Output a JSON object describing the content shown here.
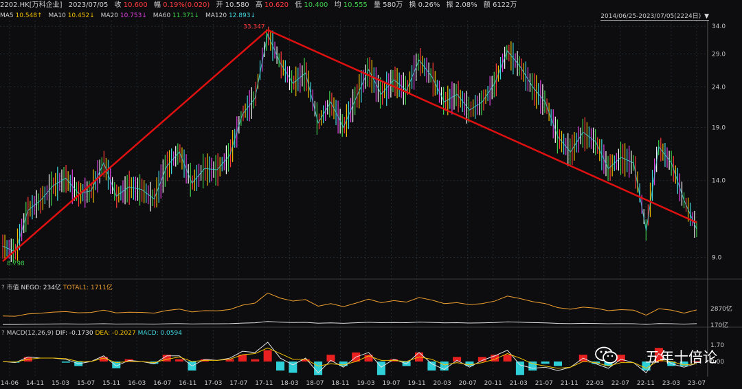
{
  "header": {
    "symbol": "2202.HK[万科企业]",
    "date": "2023/07/05",
    "close_label": "收",
    "close": "10.600",
    "change_label": "幅",
    "change": "0.19%(0.020)",
    "open_label": "开",
    "open": "10.580",
    "high_label": "高",
    "high": "10.620",
    "low_label": "低",
    "low": "10.400",
    "avg_label": "均",
    "avg": "10.555",
    "vol_label": "量",
    "vol": "580万",
    "turnover_label": "换",
    "turnover": "0.26%",
    "amp_label": "振",
    "amp": "2.08%",
    "amount_label": "额",
    "amount": "6122万"
  },
  "ma_line": [
    {
      "label": "MA5",
      "value": "10.548↑",
      "color": "#ffffff"
    },
    {
      "label": "MA10",
      "value": "10.452↓",
      "color": "#f0c000"
    },
    {
      "label": "MA20",
      "value": "10.753↓",
      "color": "#e040e0"
    },
    {
      "label": "MA60",
      "value": "11.371↓",
      "color": "#3fd04a"
    },
    {
      "label": "MA120",
      "value": "12.893↓",
      "color": "#40d8e0"
    }
  ],
  "range_label": "2014/06/25-2023/07/05(2224日)",
  "range_arrow": "▼",
  "chart_data": [
    {
      "type": "line",
      "title": "2202.HK[万科企业]",
      "y_scale": "log",
      "ylim": [
        8.4,
        34.3
      ],
      "yticks": [
        "34.0",
        "29.0",
        "24.0",
        "19.0",
        "14.0",
        "9.0"
      ],
      "xticks": [
        "14-06",
        "14-11",
        "15-03",
        "15-07",
        "15-11",
        "16-03",
        "16-07",
        "16-11",
        "17-03",
        "17-07",
        "17-11",
        "18-03",
        "18-07",
        "18-11",
        "19-03",
        "19-07",
        "19-11",
        "20-03",
        "20-07",
        "20-11",
        "21-03",
        "21-07",
        "21-11",
        "22-03",
        "22-07",
        "22-11",
        "23-03",
        "23-07"
      ],
      "annotations": {
        "high_label": "33.347",
        "low_label": "8.798"
      },
      "trendlines": [
        {
          "from": [
            "14-06",
            8.8
          ],
          "to": [
            "17-12",
            33.3
          ],
          "color": "#e01010"
        },
        {
          "from": [
            "17-12",
            33.3
          ],
          "to": [
            "23-07",
            11.0
          ],
          "color": "#e01010"
        }
      ],
      "series": [
        {
          "name": "Price",
          "x": [
            "14-06",
            "14-08",
            "14-11",
            "15-01",
            "15-03",
            "15-05",
            "15-07",
            "15-09",
            "15-11",
            "16-01",
            "16-03",
            "16-05",
            "16-07",
            "16-09",
            "16-11",
            "17-01",
            "17-03",
            "17-05",
            "17-07",
            "17-09",
            "17-11",
            "17-12",
            "18-01",
            "18-03",
            "18-05",
            "18-07",
            "18-09",
            "18-11",
            "19-01",
            "19-03",
            "19-05",
            "19-07",
            "19-09",
            "19-11",
            "20-01",
            "20-03",
            "20-05",
            "20-07",
            "20-09",
            "20-11",
            "21-01",
            "21-03",
            "21-05",
            "21-07",
            "21-09",
            "21-11",
            "22-01",
            "22-03",
            "22-05",
            "22-07",
            "22-09",
            "22-11",
            "23-01",
            "23-03",
            "23-05",
            "23-07"
          ],
          "values": [
            9.6,
            9.3,
            11.8,
            12.5,
            13.6,
            14.2,
            13.0,
            13.2,
            15.5,
            12.8,
            13.5,
            13.3,
            12.6,
            15.2,
            16.5,
            13.8,
            15.0,
            14.9,
            16.2,
            20.5,
            22.5,
            32.5,
            27.5,
            24.5,
            26.0,
            19.5,
            22.0,
            19.0,
            22.5,
            26.5,
            23.0,
            25.0,
            23.5,
            28.0,
            25.5,
            22.0,
            23.0,
            21.0,
            22.0,
            24.5,
            29.5,
            27.0,
            24.0,
            22.0,
            18.0,
            16.5,
            18.5,
            17.5,
            15.0,
            16.0,
            15.5,
            10.5,
            17.0,
            15.5,
            12.5,
            10.6
          ]
        }
      ]
    },
    {
      "type": "line",
      "title": "市值",
      "legend": [
        {
          "label": "NEGO: 234亿",
          "color": "#e0e0e0"
        },
        {
          "label": "TOTAL1: 1711亿",
          "color": "#f0a030"
        }
      ],
      "yticks": [
        "2870亿",
        "170亿"
      ],
      "series": [
        {
          "name": "TOTAL1",
          "values": [
            1050,
            1030,
            1280,
            1350,
            1470,
            1530,
            1400,
            1430,
            1680,
            1390,
            1460,
            1440,
            1360,
            1650,
            1790,
            1490,
            1630,
            1610,
            1750,
            2220,
            2440,
            3530,
            2980,
            2660,
            2820,
            2110,
            2390,
            2060,
            2440,
            2870,
            2490,
            2710,
            2550,
            3040,
            2770,
            2390,
            2490,
            2280,
            2390,
            2660,
            3200,
            2930,
            2600,
            2390,
            1950,
            1790,
            2010,
            1900,
            1630,
            1740,
            1680,
            1140,
            1840,
            1680,
            1360,
            1710
          ]
        },
        {
          "name": "NEGO",
          "values": [
            140,
            140,
            170,
            180,
            190,
            200,
            185,
            190,
            220,
            185,
            195,
            190,
            180,
            215,
            235,
            195,
            215,
            210,
            230,
            290,
            320,
            460,
            390,
            350,
            370,
            280,
            315,
            270,
            320,
            380,
            330,
            355,
            335,
            400,
            365,
            315,
            330,
            300,
            315,
            350,
            420,
            385,
            345,
            315,
            255,
            235,
            265,
            250,
            215,
            230,
            220,
            150,
            242,
            220,
            180,
            234
          ]
        }
      ]
    },
    {
      "type": "bar",
      "title": "MACD(12,26,9)",
      "legend": [
        {
          "label": "DIF: -0.1730",
          "color": "#e0e0e0"
        },
        {
          "label": "DEA: -0.2027",
          "color": "#f0c000"
        },
        {
          "label": "MACD: 0.0594",
          "color": "#40d8e0"
        }
      ],
      "yticks": [
        "1.70",
        "0.00"
      ],
      "series": [
        {
          "name": "DIF",
          "values": [
            0.0,
            -0.1,
            0.4,
            0.3,
            0.3,
            0.2,
            -0.2,
            0.0,
            0.5,
            -0.4,
            0.1,
            0.0,
            -0.2,
            0.5,
            0.5,
            -0.4,
            0.2,
            0.1,
            0.3,
            0.9,
            0.8,
            1.7,
            0.3,
            -0.3,
            0.3,
            -1.0,
            0.1,
            -0.5,
            0.4,
            0.8,
            -0.5,
            0.2,
            -0.2,
            0.8,
            -0.2,
            -0.7,
            0.1,
            -0.5,
            0.1,
            0.5,
            1.0,
            -0.3,
            -0.6,
            -0.5,
            -0.8,
            -0.5,
            0.3,
            -0.2,
            -0.6,
            0.2,
            -0.1,
            -1.0,
            0.7,
            -0.2,
            -0.5,
            -0.17
          ]
        },
        {
          "name": "DEA",
          "values": [
            0.0,
            -0.05,
            0.2,
            0.3,
            0.3,
            0.25,
            0.0,
            0.0,
            0.3,
            -0.1,
            0.0,
            0.0,
            -0.1,
            0.2,
            0.4,
            0.0,
            0.1,
            0.1,
            0.2,
            0.6,
            0.7,
            1.2,
            0.7,
            0.2,
            0.2,
            -0.4,
            -0.2,
            -0.3,
            0.0,
            0.5,
            0.1,
            0.1,
            0.0,
            0.4,
            0.2,
            -0.3,
            -0.1,
            -0.3,
            -0.1,
            0.2,
            0.7,
            0.3,
            -0.2,
            -0.4,
            -0.6,
            -0.5,
            0.0,
            -0.1,
            -0.4,
            -0.1,
            -0.1,
            -0.6,
            0.1,
            0.0,
            -0.3,
            -0.2
          ]
        }
      ]
    }
  ],
  "watermark": {
    "text": "五年十倍论",
    "icon": "wechat-icon"
  }
}
